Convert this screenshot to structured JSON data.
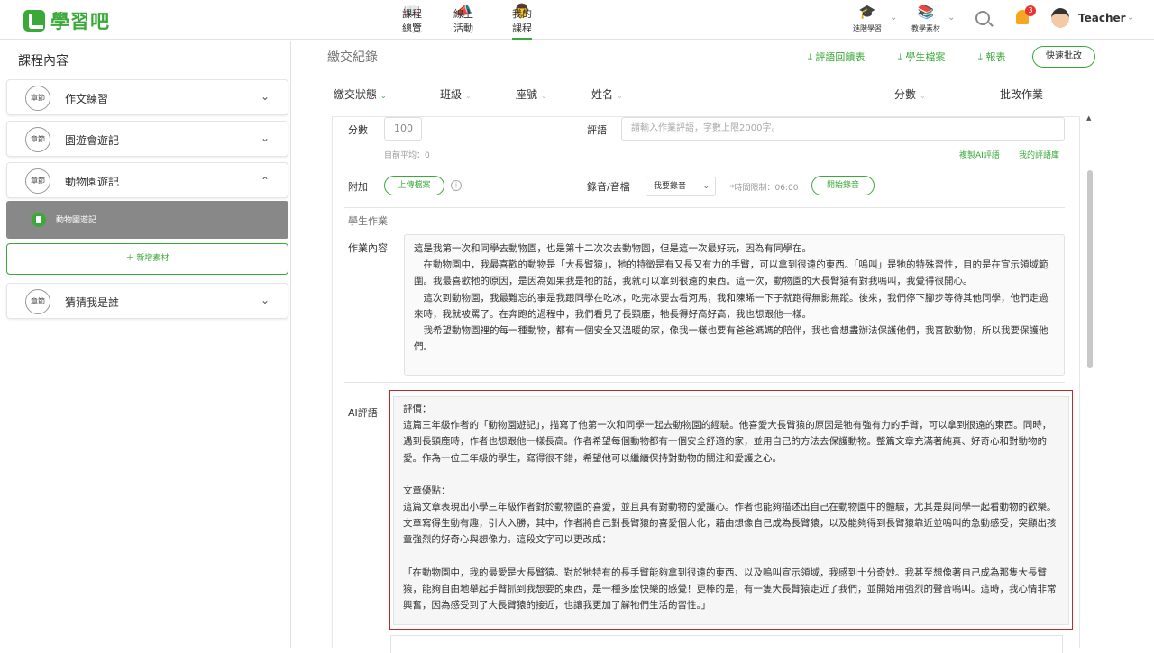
{
  "brand": {
    "name": "學習吧"
  },
  "nav": [
    {
      "label": "課程總覽",
      "icon": "book-icon"
    },
    {
      "label": "線上活動",
      "icon": "megaphone-icon"
    },
    {
      "label": "我的課程",
      "icon": "teacher-icon"
    }
  ],
  "right_nav": [
    {
      "label": "進階學習",
      "icon": "graduation-cap-icon"
    },
    {
      "label": "教學素材",
      "icon": "library-icon"
    }
  ],
  "notifications": {
    "count": "3"
  },
  "user": {
    "name": "Teacher"
  },
  "sidebar": {
    "title": "課程內容",
    "badge": "章節",
    "chapters": [
      {
        "title": "作文練習",
        "expanded": false
      },
      {
        "title": "園遊會遊記",
        "expanded": false
      },
      {
        "title": "動物園遊記",
        "expanded": true
      },
      {
        "title": "猜猜我是誰",
        "expanded": false
      }
    ],
    "sub_item": "動物園遊記",
    "add_button": "＋ 新增素材"
  },
  "main": {
    "title": "繳交紀錄",
    "links": [
      "評語回饋表",
      "學生檔案",
      "報表"
    ],
    "quick_button": "快速批改",
    "columns": [
      "繳交狀態",
      "班級",
      "座號",
      "姓名",
      "分數",
      "批改作業"
    ],
    "score_label": "分數",
    "score_value": "100",
    "average": "目前平均：0",
    "comment_label": "評語",
    "comment_placeholder": "請輸入作業評語，字數上限2000字。",
    "copy_ai": "複製AI評語",
    "my_library": "我的評語庫",
    "attach_label": "附加",
    "upload_button": "上傳檔案",
    "audio_label": "錄音/音檔",
    "audio_select": "我要錄音",
    "time_limit": "*時間限制：06:00",
    "start_record": "開始錄音",
    "student_work_title": "學生作業",
    "content_label": "作業內容",
    "essay": [
      "這是我第一次和同學去動物園，也是第十二次次去動物園，但是這一次最好玩，因為有同學在。",
      "　在動物園中，我最喜歡的動物是「大長臂猿」，牠的特徵是有又長又有力的手臂，可以拿到很遠的東西。「嗚叫」是牠的特殊習性，目的是在宣示領域範圍。我最喜歡牠的原因，是因為如果我是牠的話，我就可以拿到很遠的東西。這一次，動物園的大長臂猿有對我嗚叫，我覺得很開心。",
      "　這次到動物園，我最難忘的事是我跟同學在吃冰，吃完冰要去看河馬，我和陳睎一下子就跑得無影無蹤。後來，我們停下腳步等待其他同學，他們走過來時，我就被罵了。在奔跑的過程中，我們看見了長頸鹿，牠長得好高好高，我也想跟他一樣。",
      "　我希望動物園裡的每一種動物，都有一個安全又溫暖的家，像我一樣也要有爸爸媽媽的陪伴，我也會想盡辦法保護他們，我喜歡動物，所以我要保護他們。"
    ],
    "ai_label": "AI評語",
    "ai_comment": {
      "eval_title": "評價：",
      "eval_text": "這篇三年級作者的「動物園遊記」，描寫了他第一次和同學一起去動物園的經驗。他喜愛大長臂猿的原因是牠有強有力的手臂，可以拿到很遠的東西。同時，遇到長頸鹿時，作者也想跟他一樣長高。作者希望每個動物都有一個安全舒適的家，並用自己的方法去保護動物。整篇文章充滿著純真、好奇心和對動物的愛。作為一位三年級的學生，寫得很不錯，希望他可以繼續保持對動物的關注和愛護之心。",
      "merit_title": "文章優點：",
      "merit_text": "這篇文章表現出小學三年級作者對於動物園的喜愛，並且具有對動物的愛護心。作者也能夠描述出自己在動物園中的體驗，尤其是與同學一起看動物的歡樂。文章寫得生動有趣，引人入勝，其中，作者將自己對長臂猿的喜愛個人化，藉由想像自己成為長臂猿，以及能夠得到長臂猿靠近並嗚叫的急動感受，突顯出孩童強烈的好奇心與想像力。這段文字可以更改成：",
      "rewrite": "「在動物園中，我的最愛是大長臂猿。對於牠特有的長手臂能夠拿到很遠的東西、以及嗚叫宣示領域，我感到十分奇妙。我甚至想像著自己成為那隻大長臂猿，能夠自由地舉起手臂抓到我想要的東西，是一種多麼快樂的感覺！更棒的是，有一隻大長臂猿走近了我們，並開始用強烈的聲音嗚叫。這時，我心情非常興奮，因為感受到了大長臂猿的接近，也讓我更加了解牠們生活的習性。」"
    }
  },
  "colors": {
    "accent": "#3aa93a",
    "highlight_border": "#c0282d"
  }
}
